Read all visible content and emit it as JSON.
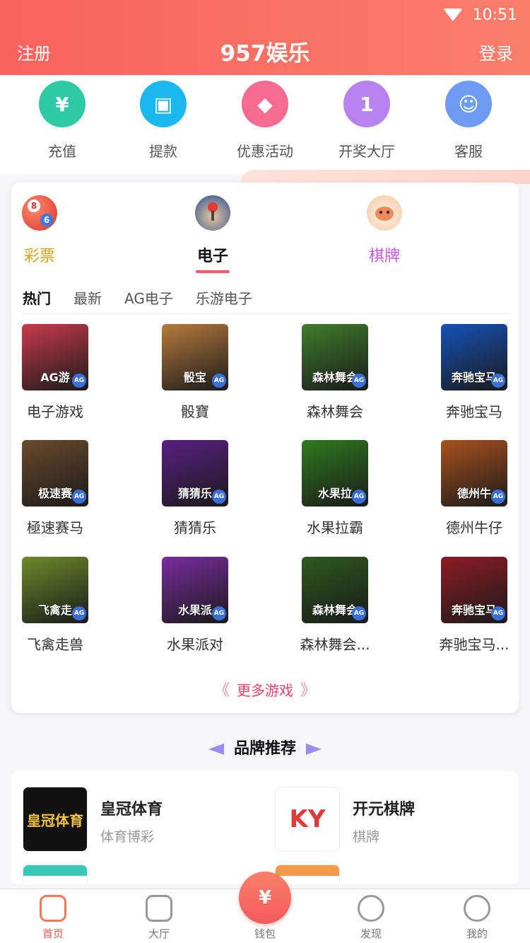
{
  "status": {
    "time": "10:51"
  },
  "header": {
    "left": "注册",
    "title": "957娱乐",
    "right": "登录"
  },
  "quick": [
    {
      "label": "充值",
      "icon": "money-bag-icon",
      "color": "#2ec9a5",
      "glyph": "¥"
    },
    {
      "label": "提款",
      "icon": "wallet-icon",
      "color": "#1bb8f0",
      "glyph": "▣"
    },
    {
      "label": "优惠活动",
      "icon": "tag-icon",
      "color": "#f76b90",
      "glyph": "◆"
    },
    {
      "label": "开奖大厅",
      "icon": "trophy-icon",
      "color": "#b883f0",
      "glyph": "1"
    },
    {
      "label": "客服",
      "icon": "support-icon",
      "color": "#6e9cf5",
      "glyph": "☺"
    }
  ],
  "categories": [
    {
      "label": "彩票",
      "color": "#d4a21b"
    },
    {
      "label": "电子",
      "color": "#111111"
    },
    {
      "label": "棋牌",
      "color": "#c45bd8"
    }
  ],
  "subtabs": [
    "热门",
    "最新",
    "AG电子",
    "乐游电子"
  ],
  "games": [
    {
      "label": "电子游戏",
      "tag": "AG游",
      "bg": "#c93a4b"
    },
    {
      "label": "骰寶",
      "tag": "骰宝",
      "bg": "#b77b3d"
    },
    {
      "label": "森林舞会",
      "tag": "森林舞会",
      "bg": "#3f7d2d"
    },
    {
      "label": "奔驰宝马",
      "tag": "奔驰宝马",
      "bg": "#1652b8"
    },
    {
      "label": "極速赛马",
      "tag": "极速赛",
      "bg": "#6b4a2c"
    },
    {
      "label": "猜猜乐",
      "tag": "猜猜乐",
      "bg": "#5a1f82"
    },
    {
      "label": "水果拉霸",
      "tag": "水果拉",
      "bg": "#2f7a1f"
    },
    {
      "label": "德州牛仔",
      "tag": "德州牛",
      "bg": "#a9521e"
    },
    {
      "label": "飞禽走兽",
      "tag": "飞禽走",
      "bg": "#6e8a2b"
    },
    {
      "label": "水果派对",
      "tag": "水果派",
      "bg": "#7a2ca0"
    },
    {
      "label": "森林舞会...",
      "tag": "森林舞会",
      "bg": "#2d5a1e"
    },
    {
      "label": "奔驰宝马...",
      "tag": "奔驰宝马",
      "bg": "#8e1c24"
    }
  ],
  "more_label": "更多游戏",
  "brand_title": "品牌推荐",
  "brands": [
    {
      "name": "皇冠体育",
      "sub": "体育博彩",
      "logo": "皇冠体育",
      "logo_bg": "#111111",
      "logo_color": "#f2c23d"
    },
    {
      "name": "开元棋牌",
      "sub": "棋牌",
      "logo": "KY",
      "logo_bg": "#ffffff",
      "logo_color": "#e03b3b"
    }
  ],
  "nav": [
    {
      "label": "首页",
      "icon": "home-icon",
      "active": true
    },
    {
      "label": "大厅",
      "icon": "grid-icon",
      "active": false
    },
    {
      "label": "钱包",
      "icon": "wallet-icon",
      "active": false
    },
    {
      "label": "发现",
      "icon": "discover-icon",
      "active": false
    },
    {
      "label": "我的",
      "icon": "profile-icon",
      "active": false
    }
  ]
}
